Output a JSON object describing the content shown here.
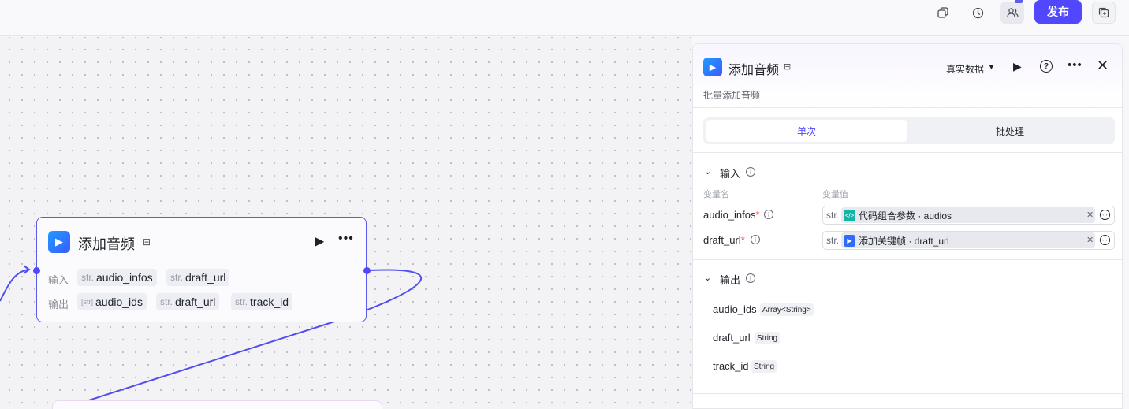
{
  "toolbar": {
    "icons": [
      "copy-icon",
      "history-icon",
      "collaborators-icon",
      "duplicate-icon"
    ],
    "publish_label": "发布"
  },
  "canvas": {
    "node": {
      "title": "添加音频",
      "input_label": "输入",
      "output_label": "输出",
      "inputs": [
        {
          "prefix": "str.",
          "name": "audio_infos"
        },
        {
          "prefix": "str.",
          "name": "draft_url"
        }
      ],
      "outputs": [
        {
          "prefix": "[str]",
          "name": "audio_ids"
        },
        {
          "prefix": "str.",
          "name": "draft_url"
        },
        {
          "prefix": "str.",
          "name": "track_id"
        }
      ]
    }
  },
  "panel": {
    "title": "添加音频",
    "description": "批量添加音频",
    "data_mode": "真实数据",
    "tabs": [
      "单次",
      "批处理"
    ],
    "active_tab": "单次",
    "input_section": {
      "title": "输入",
      "col_name": "变量名",
      "col_value": "变量值",
      "rows": [
        {
          "name": "audio_infos",
          "required": "*",
          "type_prefix": "str.",
          "source": "代码组合参数 · audios",
          "source_color": "#16b4a6"
        },
        {
          "name": "draft_url",
          "required": "*",
          "type_prefix": "str.",
          "source": "添加关键帧 · draft_url",
          "source_color": "#2f6bff"
        }
      ]
    },
    "output_section": {
      "title": "输出",
      "rows": [
        {
          "name": "audio_ids",
          "type": "Array<String>"
        },
        {
          "name": "draft_url",
          "type": "String"
        },
        {
          "name": "track_id",
          "type": "String"
        }
      ]
    }
  },
  "colors": {
    "accent": "#5147ff",
    "edge": "#4f4ff0"
  }
}
